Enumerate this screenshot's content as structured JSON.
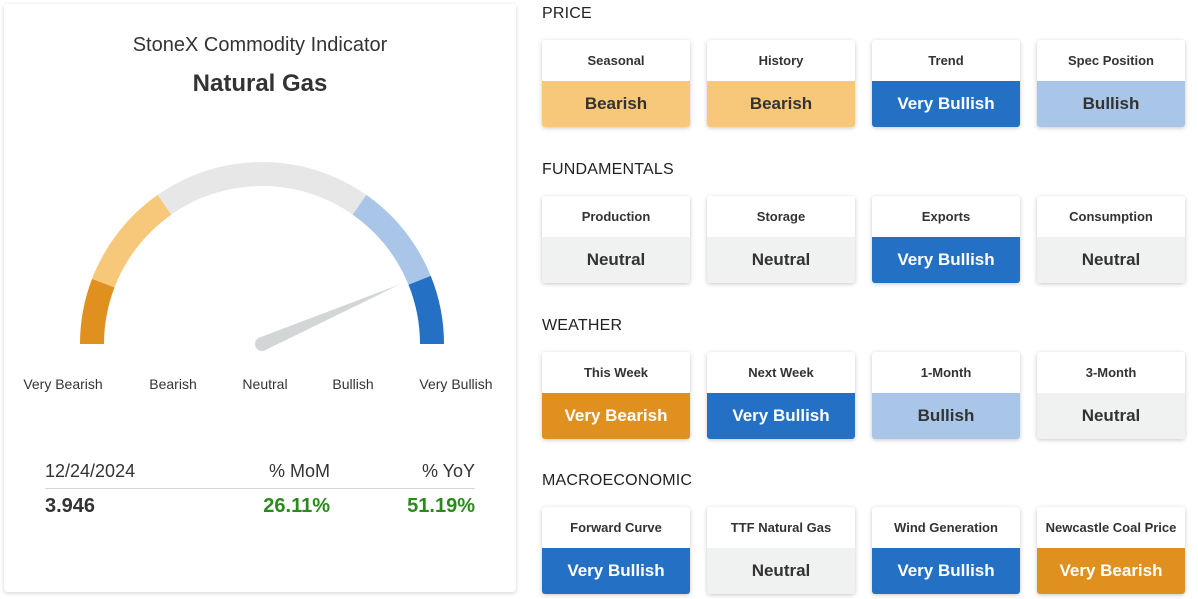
{
  "indicator": {
    "title": "StoneX Commodity Indicator",
    "commodity": "Natural Gas",
    "gauge_value_fraction": 0.87,
    "scale_labels": [
      "Very Bearish",
      "Bearish",
      "Neutral",
      "Bullish",
      "Very Bullish"
    ],
    "scale_colors": [
      "#e0901f",
      "#f7c77a",
      "#e6e7e6",
      "#a9c6e8",
      "#2470c4"
    ]
  },
  "stats": {
    "date": "12/24/2024",
    "mom_label": "% MoM",
    "yoy_label": "% YoY",
    "price": "3.946",
    "mom": "26.11%",
    "yoy": "51.19%"
  },
  "sections": [
    {
      "title": "PRICE",
      "cards": [
        {
          "label": "Seasonal",
          "value": "Bearish",
          "status": "bearish"
        },
        {
          "label": "History",
          "value": "Bearish",
          "status": "bearish"
        },
        {
          "label": "Trend",
          "value": "Very Bullish",
          "status": "very-bullish"
        },
        {
          "label": "Spec Position",
          "value": "Bullish",
          "status": "bullish"
        }
      ]
    },
    {
      "title": "FUNDAMENTALS",
      "cards": [
        {
          "label": "Production",
          "value": "Neutral",
          "status": "neutral"
        },
        {
          "label": "Storage",
          "value": "Neutral",
          "status": "neutral"
        },
        {
          "label": "Exports",
          "value": "Very Bullish",
          "status": "very-bullish"
        },
        {
          "label": "Consumption",
          "value": "Neutral",
          "status": "neutral"
        }
      ]
    },
    {
      "title": "WEATHER",
      "cards": [
        {
          "label": "This Week",
          "value": "Very Bearish",
          "status": "very-bearish"
        },
        {
          "label": "Next Week",
          "value": "Very Bullish",
          "status": "very-bullish"
        },
        {
          "label": "1-Month",
          "value": "Bullish",
          "status": "bullish"
        },
        {
          "label": "3-Month",
          "value": "Neutral",
          "status": "neutral"
        }
      ]
    },
    {
      "title": "MACROECONOMIC",
      "cards": [
        {
          "label": "Forward Curve",
          "value": "Very Bullish",
          "status": "very-bullish"
        },
        {
          "label": "TTF Natural Gas",
          "value": "Neutral",
          "status": "neutral"
        },
        {
          "label": "Wind Generation",
          "value": "Very Bullish",
          "status": "very-bullish"
        },
        {
          "label": "Newcastle Coal Price",
          "value": "Very Bearish",
          "status": "very-bearish"
        }
      ]
    }
  ]
}
